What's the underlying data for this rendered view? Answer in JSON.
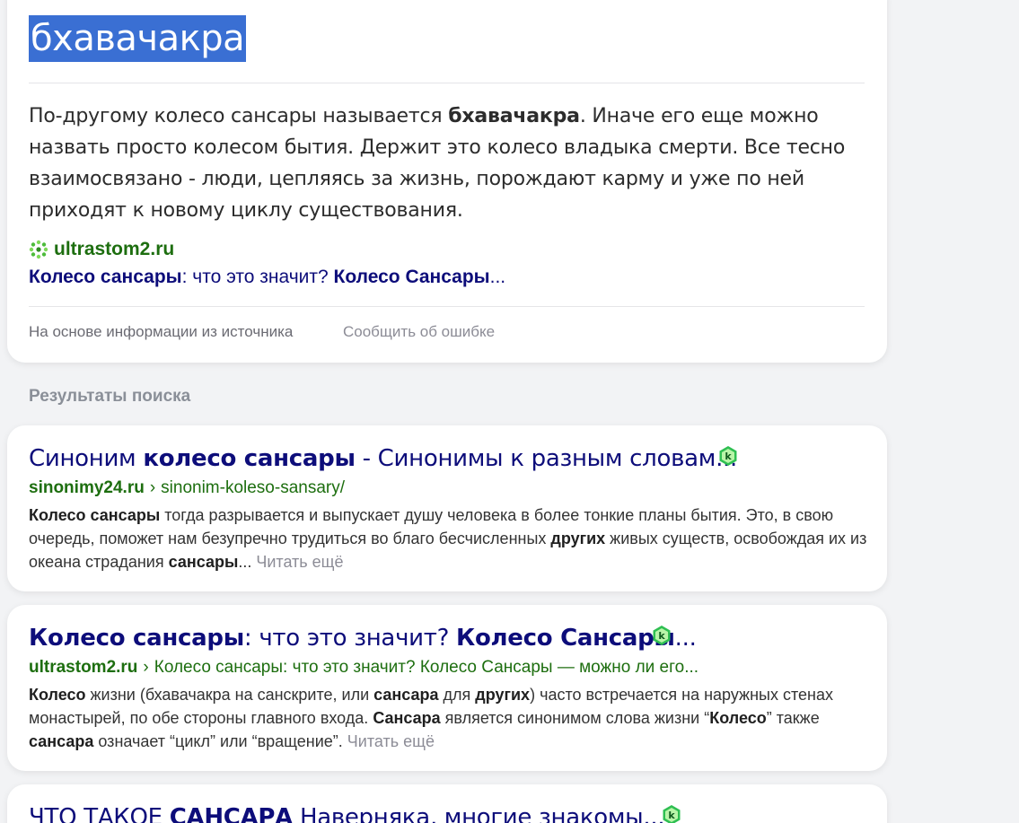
{
  "answer": {
    "title": "бхавачакра",
    "text_before": "По-другому колесо сансары называется ",
    "text_bold": "бхавачакра",
    "text_after": ". Иначе его еще можно назвать просто колесом бытия. Держит это колесо владыка смерти. Все тесно взаимосвязано - люди, цепляясь за жизнь, порождают карму и уже по ней приходят к новому циклу существования.",
    "source_domain": "ultrastom2.ru",
    "source_link_b1": "Колесо сансары",
    "source_link_t1": ": что это значит? ",
    "source_link_b2": "Колесо Сансары",
    "source_link_t2": "...",
    "footer_based": "На основе информации из источника",
    "footer_report": "Сообщить об ошибке"
  },
  "results_heading": "Результаты поиска",
  "results": [
    {
      "title_t1": "Синоним ",
      "title_b1": "колесо сансары",
      "title_t2": " - Синонимы к разным словам...",
      "domain": "sinonimy24.ru",
      "sep": "›",
      "path": "sinonim-koleso-sansary/",
      "snip_b1": "Колесо сансары",
      "snip_t1": " тогда разрывается и выпускает душу человека в более тонкие планы бытия. Это, в свою очередь, поможет нам безупречно трудиться во благо бесчисленных ",
      "snip_b2": "других",
      "snip_t2": " живых существ, освобождая их из океана страдания ",
      "snip_b3": "сансары",
      "snip_t3": "... ",
      "read_more": "Читать ещё"
    },
    {
      "title_b1": "Колесо сансары",
      "title_t1": ": что это значит? ",
      "title_b2": "Колесо Сансары",
      "title_t2": "...",
      "domain": "ultrastom2.ru",
      "sep": "›",
      "path": "Колесо сансары: что это значит? Колесо Сансары — можно ли его...",
      "snip_b1": "Колесо",
      "snip_t1": " жизни (бхавачакра на санскрите, или ",
      "snip_b2": "сансара",
      "snip_t2": " для ",
      "snip_b3": "других",
      "snip_t3": ") часто встречается на наружных стенах монастырей, по обе стороны главного входа. ",
      "snip_b4": "Сансара",
      "snip_t4": " является синонимом слова жизни “",
      "snip_b5": "Колесо",
      "snip_t5": "” также ",
      "snip_b6": "сансара",
      "snip_t6": " означает “цикл” или “вращение”. ",
      "read_more": "Читать ещё"
    },
    {
      "title_t1": "ЧТО ТАКОЕ ",
      "title_b1": "САНСАРА",
      "title_t2": " Наверняка, многие знакомы..."
    }
  ],
  "colors": {
    "title_link": "#0d0d7a",
    "url_green": "#1d6e0f",
    "highlight": "#3a6fd3",
    "badge_green": "#2fbf52",
    "background": "#f2f3f5"
  },
  "icons": {
    "site_favicon": "green-dots-favicon-icon",
    "verified_badge": "kaspersky-k-badge-icon"
  }
}
